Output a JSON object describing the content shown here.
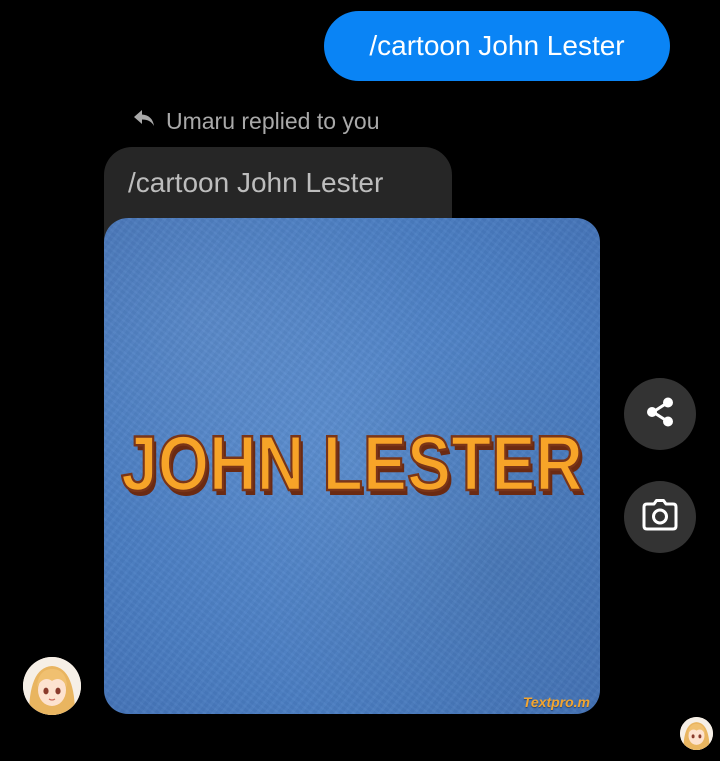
{
  "outgoing_message": {
    "text": "/cartoon John Lester"
  },
  "reply_indicator": {
    "label": "Umaru replied to you"
  },
  "quoted_message": {
    "text": "/cartoon John Lester"
  },
  "image": {
    "art_text": "JOHN LESTER",
    "watermark": "Textpro.m"
  },
  "actions": {
    "share_icon": "share-icon",
    "camera_icon": "camera-icon"
  },
  "colors": {
    "outgoing_bubble": "#0a84f5",
    "background": "#000000",
    "art_text_fill": "#f7a428"
  }
}
